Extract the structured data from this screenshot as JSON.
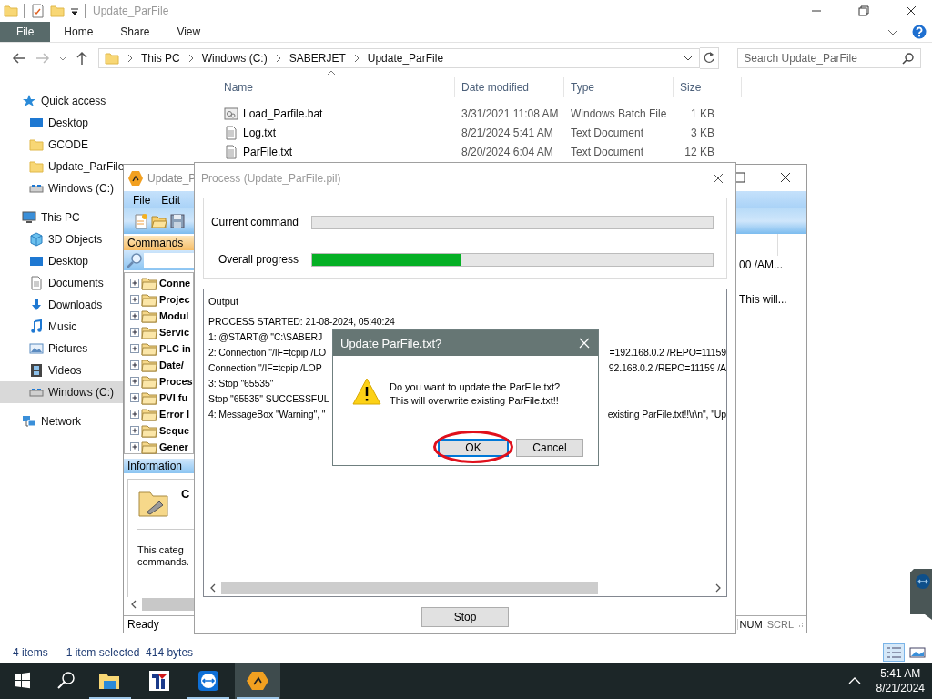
{
  "explorer": {
    "title": "Update_ParFile",
    "ribbon_tabs": [
      {
        "label": "File",
        "selected": true
      },
      {
        "label": "Home",
        "selected": false
      },
      {
        "label": "Share",
        "selected": false
      },
      {
        "label": "View",
        "selected": false
      }
    ],
    "address": [
      "This PC",
      "Windows (C:)",
      "SABERJET",
      "Update_ParFile"
    ],
    "search": {
      "placeholder": "Search Update_ParFile"
    },
    "nav": [
      {
        "label": "Quick access",
        "kind": "star",
        "selected": false,
        "children": [
          {
            "label": "Desktop",
            "kind": "desktop",
            "selected": false
          },
          {
            "label": "GCODE",
            "kind": "folder",
            "selected": false
          },
          {
            "label": "Update_ParFile",
            "kind": "folder",
            "selected": false
          },
          {
            "label": "Windows (C:)",
            "kind": "drive",
            "selected": false
          }
        ]
      },
      {
        "label": "This PC",
        "kind": "pc",
        "selected": false,
        "children": [
          {
            "label": "3D Objects",
            "kind": "cube",
            "selected": false
          },
          {
            "label": "Desktop",
            "kind": "desktop",
            "selected": false
          },
          {
            "label": "Documents",
            "kind": "documents",
            "selected": false
          },
          {
            "label": "Downloads",
            "kind": "download",
            "selected": false
          },
          {
            "label": "Music",
            "kind": "music",
            "selected": false
          },
          {
            "label": "Pictures",
            "kind": "pictures",
            "selected": false
          },
          {
            "label": "Videos",
            "kind": "videos",
            "selected": false
          },
          {
            "label": "Windows (C:)",
            "kind": "drive",
            "selected": true
          }
        ]
      },
      {
        "label": "Network",
        "kind": "network",
        "selected": false
      }
    ],
    "columns": [
      "Name",
      "Date modified",
      "Type",
      "Size"
    ],
    "files": [
      {
        "name": "Load_Parfile.bat",
        "date": "3/31/2021 11:08 AM",
        "type": "Windows Batch File",
        "size": "1 KB",
        "kind": "batch"
      },
      {
        "name": "Log.txt",
        "date": "8/21/2024 5:41 AM",
        "type": "Text Document",
        "size": "3 KB",
        "kind": "text"
      },
      {
        "name": "ParFile.txt",
        "date": "8/20/2024 6:04 AM",
        "type": "Text Document",
        "size": "12 KB",
        "kind": "text"
      }
    ],
    "status": {
      "count": "4 items",
      "selection": "1 item selected  414 bytes"
    },
    "views": [
      {
        "selected": true
      },
      {
        "selected": false
      }
    ]
  },
  "app": {
    "title": "Update_P",
    "menu": [
      "File",
      "Edit"
    ],
    "commands_header": "Commands",
    "tree": [
      {
        "label": "Conne",
        "expanded": false
      },
      {
        "label": "Projec",
        "expanded": false
      },
      {
        "label": "Modul",
        "expanded": false
      },
      {
        "label": "Servic",
        "expanded": false
      },
      {
        "label": "PLC in",
        "expanded": false
      },
      {
        "label": "Date/",
        "expanded": false
      },
      {
        "label": "Proces",
        "expanded": false
      },
      {
        "label": "PVI fu",
        "expanded": false
      },
      {
        "label": "Error I",
        "expanded": false
      },
      {
        "label": "Seque",
        "expanded": false
      },
      {
        "label": "Gener",
        "expanded": false
      }
    ],
    "info_header": "Information",
    "info_title": "C",
    "info_text": "This categ\ncommands.",
    "list_rows": [
      "00 /AM...",
      "This will..."
    ],
    "status": "Ready",
    "indicators": [
      "NUM",
      "SCRL"
    ]
  },
  "process": {
    "title": "Process (Update_ParFile.pil)",
    "progress": [
      {
        "label": "Current command",
        "level": 0
      },
      {
        "label": "Overall progress",
        "level": 0.37
      }
    ],
    "output_label": "Output",
    "output": [
      {
        "left": "PROCESS STARTED: 21-08-2024, 05:40:24"
      },
      {
        "left": "1: @START@ \"C:\\SABERJ"
      },
      {
        "left": "2: Connection \"/IF=tcpip /LO",
        "right": "=192.168.0.2 /REPO=11159"
      },
      {
        "left": "Connection \"/IF=tcpip /LOP",
        "right": "92.168.0.2 /REPO=11159 /A"
      },
      {
        "left": "3: Stop \"65535\""
      },
      {
        "left": "Stop \"65535\" SUCCESSFUL"
      },
      {
        "left": "4: MessageBox \"Warning\", \"",
        "right": "existing ParFile.txt!!\\r\\n\", \"Up"
      }
    ],
    "stop": "Stop"
  },
  "dialog": {
    "title": "Update ParFile.txt?",
    "message": "Do you want to update the ParFile.txt?\nThis will overwrite existing ParFile.txt!!",
    "buttons": [
      {
        "label": "OK",
        "focused": true,
        "circled": true
      },
      {
        "label": "Cancel",
        "focused": false,
        "circled": false
      }
    ]
  },
  "taskbar": {
    "apps": [
      {
        "running": true,
        "active": false
      },
      {
        "running": false,
        "active": false
      },
      {
        "running": true,
        "active": false
      },
      {
        "running": true,
        "active": true
      }
    ],
    "time": "5:41 AM",
    "date": "8/21/2024"
  }
}
